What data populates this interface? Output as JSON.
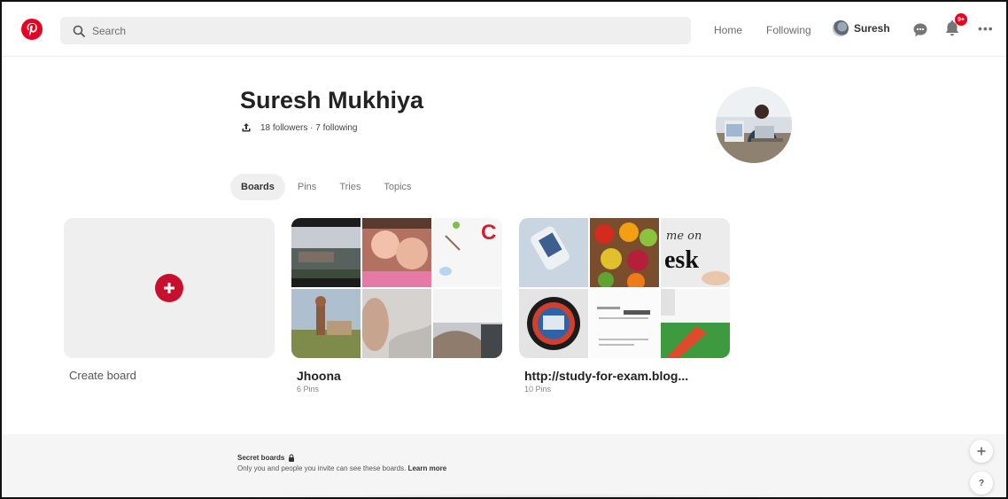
{
  "header": {
    "search_placeholder": "Search",
    "home_label": "Home",
    "following_label": "Following",
    "user_name": "Suresh",
    "notification_badge": "9+"
  },
  "profile": {
    "name": "Suresh Mukhiya",
    "stats": "18 followers · 7 following"
  },
  "tabs": [
    "Boards",
    "Pins",
    "Tries",
    "Topics"
  ],
  "active_tab": "Boards",
  "boards": [
    {
      "title": "Create board"
    },
    {
      "title": "Jhoona",
      "count": "6 Pins"
    },
    {
      "title": "http://study-for-exam.blog...",
      "count": "10 Pins"
    }
  ],
  "secret": {
    "title": "Secret boards",
    "description": "Only you and people you invite can see these boards.",
    "link": "Learn more"
  },
  "help_label": "?",
  "colors": {
    "brand": "#e60023",
    "create_plus": "#c8102e",
    "surface": "#efefef"
  }
}
